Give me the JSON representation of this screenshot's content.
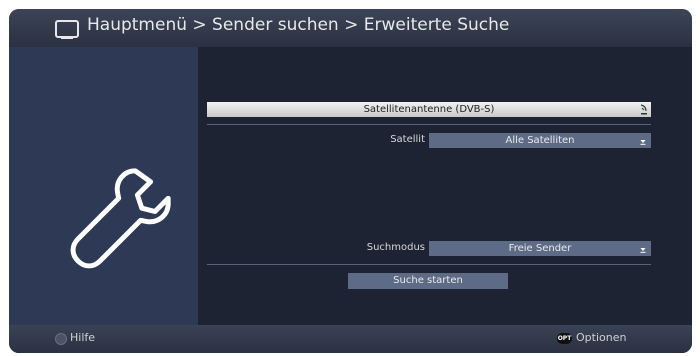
{
  "header": {
    "breadcrumb": "Hauptmenü > Sender suchen > Erweiterte Suche",
    "icon": "tv-icon"
  },
  "left_panel": {
    "icon": "wrench-icon"
  },
  "form": {
    "source": "Satellitenantenne (DVB-S)",
    "source_icon": "satellite-dish-icon",
    "satellite": {
      "label": "Satellit",
      "value": "Alle Satelliten"
    },
    "search_mode": {
      "label": "Suchmodus",
      "value": "Freie Sender"
    },
    "start_button": "Suche starten"
  },
  "footer": {
    "help": {
      "label": "Hilfe",
      "color_button": "grey"
    },
    "options": {
      "label": "Optionen",
      "badge": "OPT"
    }
  },
  "colors": {
    "background": "#1d2332",
    "left_panel": "#2e3a55",
    "select": "#5e6b86",
    "highlight": "#e6e6e6"
  }
}
